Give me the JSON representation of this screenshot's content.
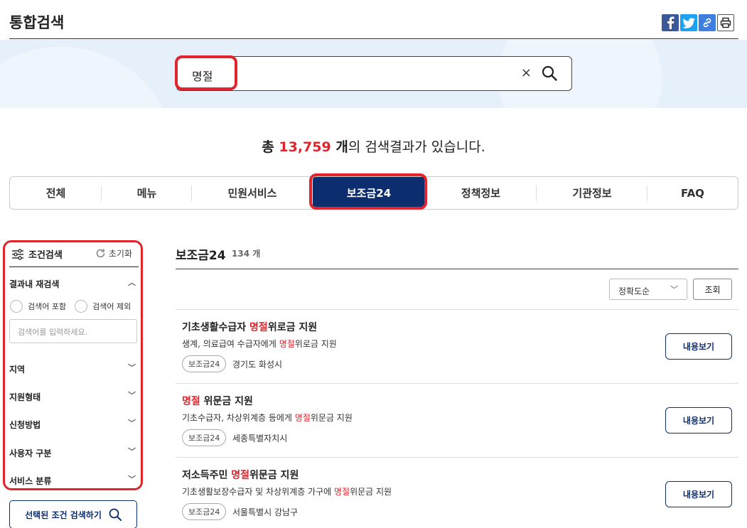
{
  "header": {
    "title": "통합검색",
    "share_icons": [
      "facebook-icon",
      "twitter-icon",
      "link-icon",
      "print-icon"
    ]
  },
  "search": {
    "value": "명절",
    "clear_glyph": "×"
  },
  "summary": {
    "prefix": "총 ",
    "count": "13,759",
    "unit": " 개",
    "suffix": "의 검색결과가 있습니다."
  },
  "tabs": [
    {
      "label": "전체"
    },
    {
      "label": "메뉴"
    },
    {
      "label": "민원서비스"
    },
    {
      "label": "보조금24",
      "active": true
    },
    {
      "label": "정책정보"
    },
    {
      "label": "기관정보"
    },
    {
      "label": "FAQ"
    }
  ],
  "sidebar": {
    "title": "조건검색",
    "reset": "초기화",
    "within": "결과내 재검색",
    "include": "검색어 포함",
    "exclude": "검색어 제외",
    "keyword_placeholder": "검색어를 입력하세요.",
    "filters": [
      "지역",
      "지원형태",
      "신청방법",
      "사용자 구분",
      "서비스 분류"
    ],
    "submit": "선택된 조건 검색하기"
  },
  "results": {
    "title": "보조금24",
    "count": "134 개",
    "sort": "정확도순",
    "query_button": "조회",
    "view_label": "내용보기",
    "items": [
      {
        "title_pre": "기초생활수급자 ",
        "title_hl": "명절",
        "title_post": "위로금 지원",
        "desc_pre": "생계, 의료급여 수급자에게 ",
        "desc_hl": "명절",
        "desc_post": "위로금 지원",
        "badge": "보조금24",
        "location": "경기도 화성시"
      },
      {
        "title_pre": "",
        "title_hl": "명절",
        "title_post": " 위문금 지원",
        "desc_pre": "기초수급자, 차상위계층 등에게 ",
        "desc_hl": "명절",
        "desc_post": "위문금 지원",
        "badge": "보조금24",
        "location": "세종특별자치시"
      },
      {
        "title_pre": "저소득주민 ",
        "title_hl": "명절",
        "title_post": "위문금 지원",
        "desc_pre": "기초생활보장수급자 및 차상위계층 가구에 ",
        "desc_hl": "명절",
        "desc_post": "위문금 지원",
        "badge": "보조금24",
        "location": "서울특별시 강남구"
      }
    ]
  },
  "colors": {
    "accent_red": "#e0252f",
    "navy": "#0d2e6e",
    "band": "#e5f0fb"
  }
}
